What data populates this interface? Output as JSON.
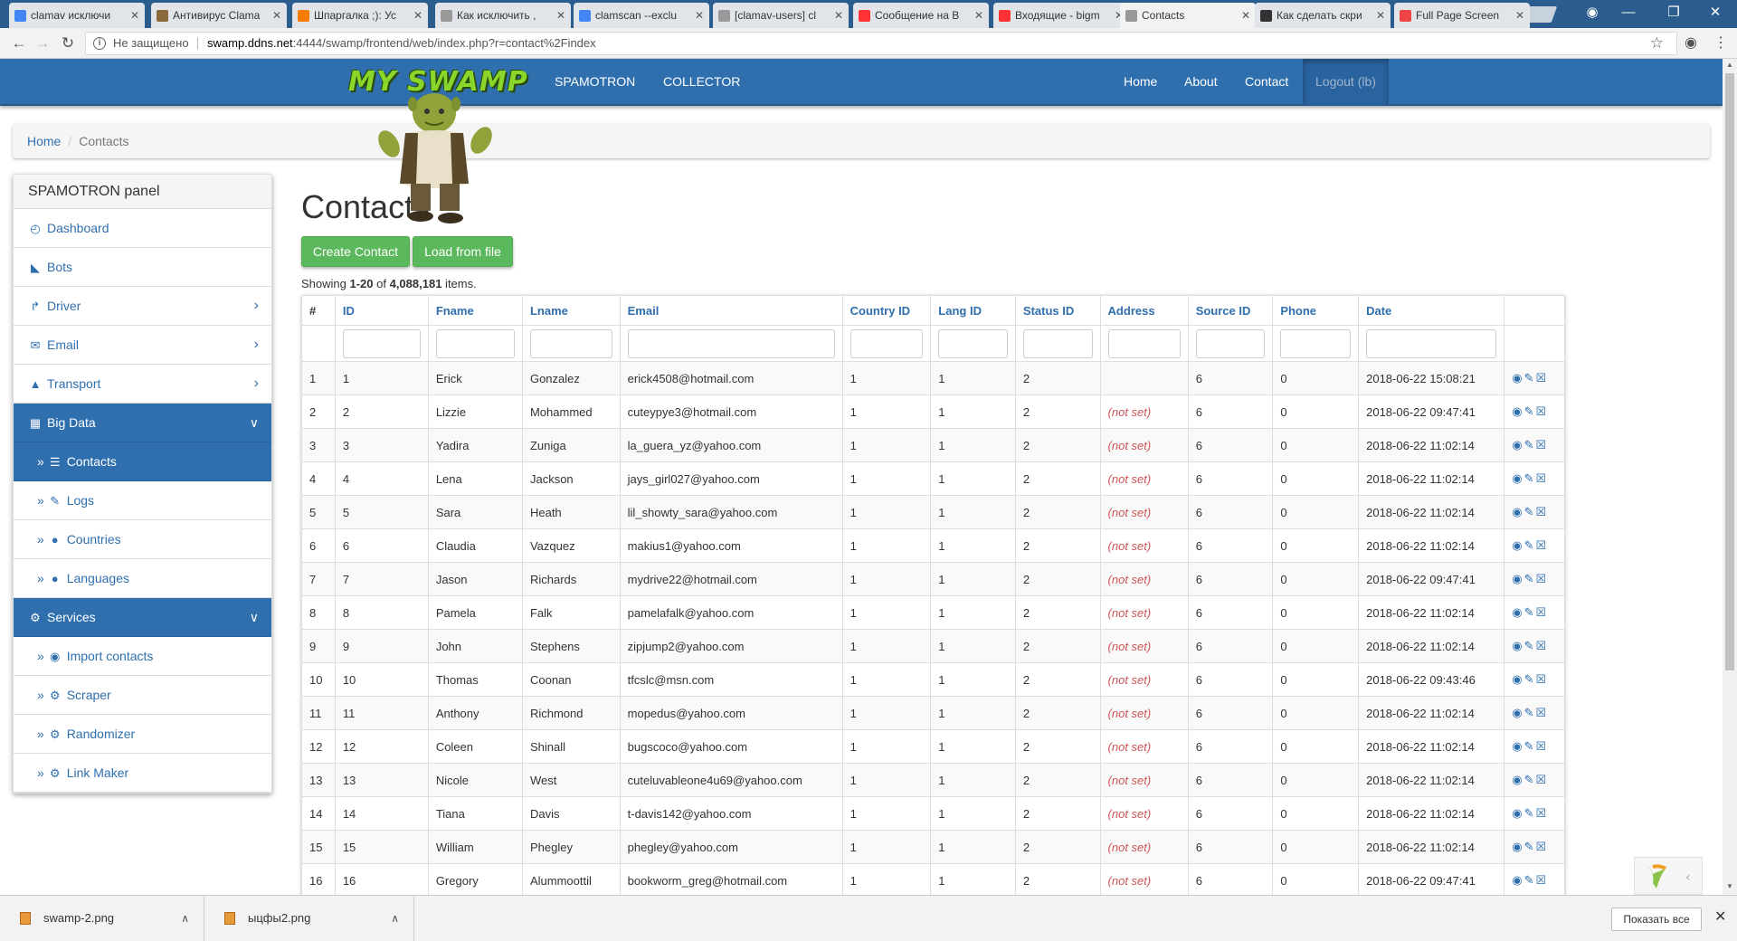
{
  "browser": {
    "tabs": [
      {
        "label": "clamav исключи",
        "icon_color": "#4285f4",
        "active": false
      },
      {
        "label": "Антивирус Clama",
        "icon_color": "#8a6a3a",
        "active": false
      },
      {
        "label": "Шпаргалка ;): Ус",
        "icon_color": "#f57c00",
        "active": false
      },
      {
        "label": "Как исключить ,",
        "icon_color": "#999999",
        "active": false
      },
      {
        "label": "clamscan --exclu",
        "icon_color": "#4285f4",
        "active": false
      },
      {
        "label": "[clamav-users] cl",
        "icon_color": "#999999",
        "active": false
      },
      {
        "label": "Сообщение на B",
        "icon_color": "#ff3333",
        "active": false
      },
      {
        "label": "Входящие - bigm",
        "icon_color": "#ff3333",
        "active": false
      },
      {
        "label": "Contacts",
        "icon_color": "#999999",
        "active": true
      },
      {
        "label": "Как сделать скри",
        "icon_color": "#333333",
        "active": false
      },
      {
        "label": "Full Page Screen",
        "icon_color": "#e44",
        "active": false
      }
    ],
    "not_secure": "Не защищено",
    "url_host": "swamp.ddns.net",
    "url_rest": ":4444/swamp/frontend/web/index.php?r=contact%2Findex"
  },
  "navbar": {
    "brand": "MY SWAMP",
    "left": [
      "SPAMOTRON",
      "COLLECTOR"
    ],
    "right": [
      "Home",
      "About",
      "Contact"
    ],
    "logout": "Logout (lb)"
  },
  "breadcrumb": {
    "home": "Home",
    "current": "Contacts"
  },
  "sidebar": {
    "title": "SPAMOTRON panel",
    "items": [
      {
        "label": "Dashboard",
        "icon": "dashboard-icon"
      },
      {
        "label": "Bots",
        "icon": "graduation-cap-icon"
      },
      {
        "label": "Driver",
        "icon": "share-icon",
        "chevron": true
      },
      {
        "label": "Email",
        "icon": "envelope-icon",
        "chevron": true
      },
      {
        "label": "Transport",
        "icon": "road-icon",
        "chevron": true
      },
      {
        "label": "Big Data",
        "icon": "grid-icon",
        "section": true
      },
      {
        "label": "Contacts",
        "icon": "list-icon",
        "sub": true,
        "active": true
      },
      {
        "label": "Logs",
        "icon": "pencil-icon",
        "sub": true
      },
      {
        "label": "Countries",
        "icon": "globe-icon",
        "sub": true
      },
      {
        "label": "Languages",
        "icon": "globe-icon",
        "sub": true
      },
      {
        "label": "Services",
        "icon": "cog-icon",
        "section": true
      },
      {
        "label": "Import contacts",
        "icon": "import-icon",
        "sub": true
      },
      {
        "label": "Scraper",
        "icon": "cog-icon",
        "sub": true
      },
      {
        "label": "Randomizer",
        "icon": "cog-icon",
        "sub": true
      },
      {
        "label": "Link Maker",
        "icon": "cog-icon",
        "sub": true
      }
    ]
  },
  "page": {
    "title": "Contacts",
    "create_button": "Create Contact",
    "load_button": "Load from file",
    "summary_prefix": "Showing ",
    "summary_range": "1-20",
    "summary_of": " of ",
    "summary_total": "4,088,181",
    "summary_suffix": " items."
  },
  "table": {
    "columns": [
      "#",
      "ID",
      "Fname",
      "Lname",
      "Email",
      "Country ID",
      "Lang ID",
      "Status ID",
      "Address",
      "Source ID",
      "Phone",
      "Date"
    ],
    "not_set": "(not set)",
    "rows": [
      [
        "1",
        "1",
        "Erick",
        "Gonzalez",
        "erick4508@hotmail.com",
        "1",
        "1",
        "2",
        "",
        "6",
        "0",
        "2018-06-22 15:08:21"
      ],
      [
        "2",
        "2",
        "Lizzie",
        "Mohammed",
        "cuteypye3@hotmail.com",
        "1",
        "1",
        "2",
        "(not set)",
        "6",
        "0",
        "2018-06-22 09:47:41"
      ],
      [
        "3",
        "3",
        "Yadira",
        "Zuniga",
        "la_guera_yz@yahoo.com",
        "1",
        "1",
        "2",
        "(not set)",
        "6",
        "0",
        "2018-06-22 11:02:14"
      ],
      [
        "4",
        "4",
        "Lena",
        "Jackson",
        "jays_girl027@yahoo.com",
        "1",
        "1",
        "2",
        "(not set)",
        "6",
        "0",
        "2018-06-22 11:02:14"
      ],
      [
        "5",
        "5",
        "Sara",
        "Heath",
        "lil_showty_sara@yahoo.com",
        "1",
        "1",
        "2",
        "(not set)",
        "6",
        "0",
        "2018-06-22 11:02:14"
      ],
      [
        "6",
        "6",
        "Claudia",
        "Vazquez",
        "makius1@yahoo.com",
        "1",
        "1",
        "2",
        "(not set)",
        "6",
        "0",
        "2018-06-22 11:02:14"
      ],
      [
        "7",
        "7",
        "Jason",
        "Richards",
        "mydrive22@hotmail.com",
        "1",
        "1",
        "2",
        "(not set)",
        "6",
        "0",
        "2018-06-22 09:47:41"
      ],
      [
        "8",
        "8",
        "Pamela",
        "Falk",
        "pamelafalk@yahoo.com",
        "1",
        "1",
        "2",
        "(not set)",
        "6",
        "0",
        "2018-06-22 11:02:14"
      ],
      [
        "9",
        "9",
        "John",
        "Stephens",
        "zipjump2@yahoo.com",
        "1",
        "1",
        "2",
        "(not set)",
        "6",
        "0",
        "2018-06-22 11:02:14"
      ],
      [
        "10",
        "10",
        "Thomas",
        "Coonan",
        "tfcslc@msn.com",
        "1",
        "1",
        "2",
        "(not set)",
        "6",
        "0",
        "2018-06-22 09:43:46"
      ],
      [
        "11",
        "11",
        "Anthony",
        "Richmond",
        "mopedus@yahoo.com",
        "1",
        "1",
        "2",
        "(not set)",
        "6",
        "0",
        "2018-06-22 11:02:14"
      ],
      [
        "12",
        "12",
        "Coleen",
        "Shinall",
        "bugscoco@yahoo.com",
        "1",
        "1",
        "2",
        "(not set)",
        "6",
        "0",
        "2018-06-22 11:02:14"
      ],
      [
        "13",
        "13",
        "Nicole",
        "West",
        "cuteluvableone4u69@yahoo.com",
        "1",
        "1",
        "2",
        "(not set)",
        "6",
        "0",
        "2018-06-22 11:02:14"
      ],
      [
        "14",
        "14",
        "Tiana",
        "Davis",
        "t-davis142@yahoo.com",
        "1",
        "1",
        "2",
        "(not set)",
        "6",
        "0",
        "2018-06-22 11:02:14"
      ],
      [
        "15",
        "15",
        "William",
        "Phegley",
        "phegley@yahoo.com",
        "1",
        "1",
        "2",
        "(not set)",
        "6",
        "0",
        "2018-06-22 11:02:14"
      ],
      [
        "16",
        "16",
        "Gregory",
        "Alummoottil",
        "bookworm_greg@hotmail.com",
        "1",
        "1",
        "2",
        "(not set)",
        "6",
        "0",
        "2018-06-22 09:47:41"
      ]
    ]
  },
  "downloads": {
    "files": [
      "swamp-2.png",
      "ыцфы2.png"
    ],
    "show_all": "Показать все"
  },
  "colors": {
    "brand": "#2f6fae",
    "success": "#5cb85c",
    "not_set": "#cc5555"
  }
}
